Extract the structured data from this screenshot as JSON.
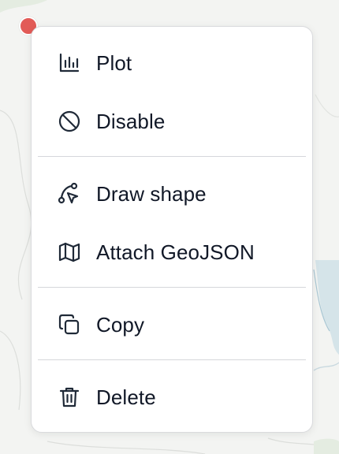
{
  "colors": {
    "marker": "#e25b57",
    "menu_background": "#ffffff",
    "text": "#111827"
  },
  "context_menu": {
    "groups": [
      {
        "items": [
          {
            "label": "Plot",
            "icon": "bar-chart-icon"
          },
          {
            "label": "Disable",
            "icon": "ban-icon"
          }
        ]
      },
      {
        "items": [
          {
            "label": "Draw shape",
            "icon": "draw-shape-icon"
          },
          {
            "label": "Attach GeoJSON",
            "icon": "map-icon"
          }
        ]
      },
      {
        "items": [
          {
            "label": "Copy",
            "icon": "copy-icon"
          }
        ]
      },
      {
        "items": [
          {
            "label": "Delete",
            "icon": "trash-icon"
          }
        ]
      }
    ]
  }
}
